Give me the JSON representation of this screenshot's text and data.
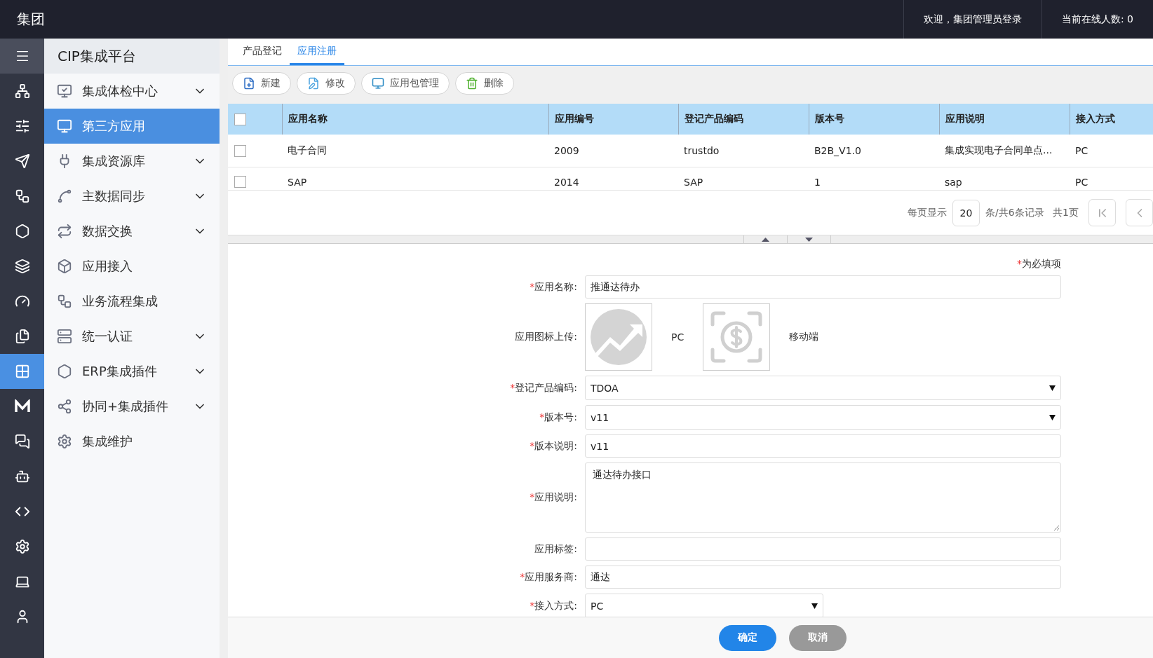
{
  "header": {
    "title": "集团",
    "welcome": "欢迎，集团管理员登录",
    "online": "当前在线人数: 0"
  },
  "rail": {
    "items": [
      {
        "selected": false
      },
      {
        "selected": false
      },
      {
        "selected": false
      },
      {
        "selected": false
      },
      {
        "selected": false
      },
      {
        "selected": false
      },
      {
        "selected": false
      },
      {
        "selected": false
      },
      {
        "selected": true
      },
      {
        "selected": false
      },
      {
        "selected": false
      },
      {
        "selected": false
      },
      {
        "selected": false
      },
      {
        "selected": false
      },
      {
        "selected": false
      },
      {
        "selected": false
      }
    ]
  },
  "sidebar": {
    "title": "CIP集成平台",
    "items": [
      {
        "label": "集成体检中心",
        "expandable": true,
        "selected": false
      },
      {
        "label": "第三方应用",
        "expandable": false,
        "selected": true
      },
      {
        "label": "集成资源库",
        "expandable": true,
        "selected": false
      },
      {
        "label": "主数据同步",
        "expandable": true,
        "selected": false
      },
      {
        "label": "数据交换",
        "expandable": true,
        "selected": false
      },
      {
        "label": "应用接入",
        "expandable": false,
        "selected": false
      },
      {
        "label": "业务流程集成",
        "expandable": false,
        "selected": false
      },
      {
        "label": "统一认证",
        "expandable": true,
        "selected": false
      },
      {
        "label": "ERP集成插件",
        "expandable": true,
        "selected": false
      },
      {
        "label": "协同+集成插件",
        "expandable": true,
        "selected": false
      },
      {
        "label": "集成维护",
        "expandable": false,
        "selected": false
      }
    ]
  },
  "tabs": [
    {
      "label": "产品登记",
      "selected": false
    },
    {
      "label": "应用注册",
      "selected": true
    }
  ],
  "toolbar": [
    {
      "label": "新建"
    },
    {
      "label": "修改"
    },
    {
      "label": "应用包管理"
    },
    {
      "label": "删除"
    }
  ],
  "table": {
    "header_checked": false,
    "columns": [
      "应用名称",
      "应用编号",
      "登记产品编码",
      "版本号",
      "应用说明",
      "接入方式"
    ],
    "rows": [
      {
        "checked": false,
        "cells": [
          "电子合同",
          "2009",
          "trustdo",
          "B2B_V1.0",
          "集成实现电子合同单点...",
          "PC"
        ]
      },
      {
        "checked": false,
        "cells": [
          "SAP",
          "2014",
          "SAP",
          "1",
          "sap",
          "PC"
        ]
      }
    ]
  },
  "pagination": {
    "per_page_label": "每页显示",
    "page_size": "20",
    "records": "条/共6条记录",
    "pages": "共1页"
  },
  "form": {
    "required_note": {
      "mark": "*",
      "text": "为必填项"
    },
    "fields": [
      {
        "kind": "text",
        "mark": "*",
        "label": "应用名称:",
        "value": "推通达待办"
      },
      {
        "kind": "upload",
        "label": "应用图标上传:",
        "captions": [
          "PC",
          "移动端"
        ]
      },
      {
        "kind": "select",
        "mark": "*",
        "label": "登记产品编码:",
        "value": "TDOA"
      },
      {
        "kind": "select",
        "mark": "*",
        "label": "版本号:",
        "value": "v11"
      },
      {
        "kind": "text",
        "mark": "*",
        "label": "版本说明:",
        "value": "v11"
      },
      {
        "kind": "textarea",
        "mark": "*",
        "label": "应用说明:",
        "value": "通达待办接口"
      },
      {
        "kind": "text",
        "label": "应用标签:"
      },
      {
        "kind": "text",
        "mark": "*",
        "label": "应用服务商:",
        "value": "通达"
      },
      {
        "kind": "short_select",
        "mark": "*",
        "label": "接入方式:",
        "value": "PC"
      }
    ]
  },
  "footer": {
    "confirm": "确定",
    "cancel": "取消"
  }
}
